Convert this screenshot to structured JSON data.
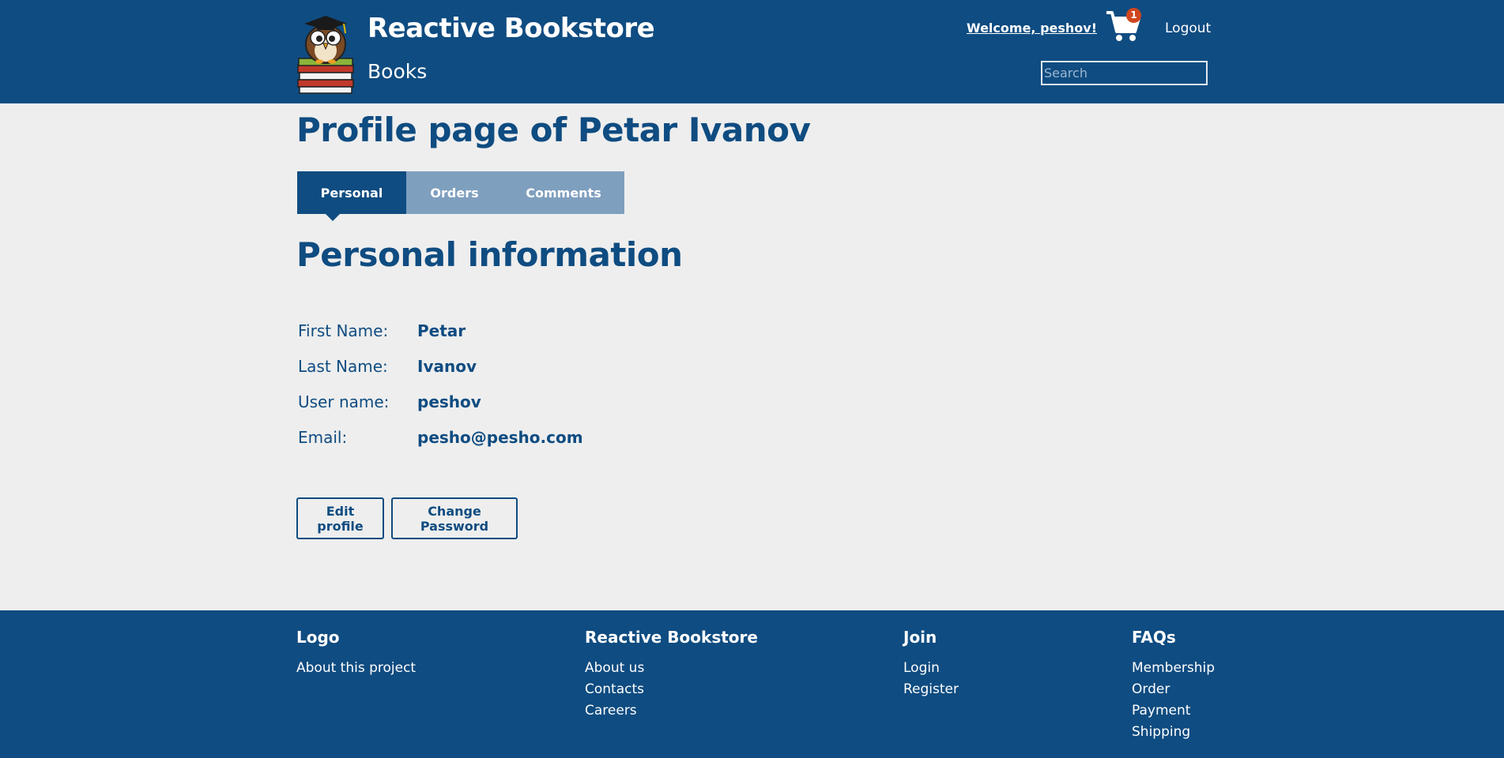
{
  "header": {
    "site_title": "Reactive Bookstore",
    "section_title": "Books",
    "welcome": "Welcome, peshov!",
    "cart_count": "1",
    "logout": "Logout",
    "search_placeholder": "Search",
    "brand_color": "#0f4c81"
  },
  "main": {
    "page_title": "Profile page of Petar Ivanov",
    "tabs": [
      {
        "label": "Personal",
        "active": true
      },
      {
        "label": "Orders",
        "active": false
      },
      {
        "label": "Comments",
        "active": false
      }
    ],
    "section_heading": "Personal information",
    "fields": [
      {
        "label": "First Name:",
        "value": "Petar"
      },
      {
        "label": "Last Name:",
        "value": "Ivanov"
      },
      {
        "label": "User name:",
        "value": "peshov"
      },
      {
        "label": "Email:",
        "value": "pesho@pesho.com"
      }
    ],
    "edit_profile": "Edit profile",
    "change_password": "Change Password"
  },
  "footer": {
    "columns": [
      {
        "title": "Logo",
        "links": [
          "About this project"
        ]
      },
      {
        "title": "Reactive Bookstore",
        "links": [
          "About us",
          "Contacts",
          "Careers"
        ]
      },
      {
        "title": "Join",
        "links": [
          "Login",
          "Register"
        ]
      },
      {
        "title": "FAQs",
        "links": [
          "Membership",
          "Order",
          "Payment",
          "Shipping"
        ]
      }
    ]
  }
}
